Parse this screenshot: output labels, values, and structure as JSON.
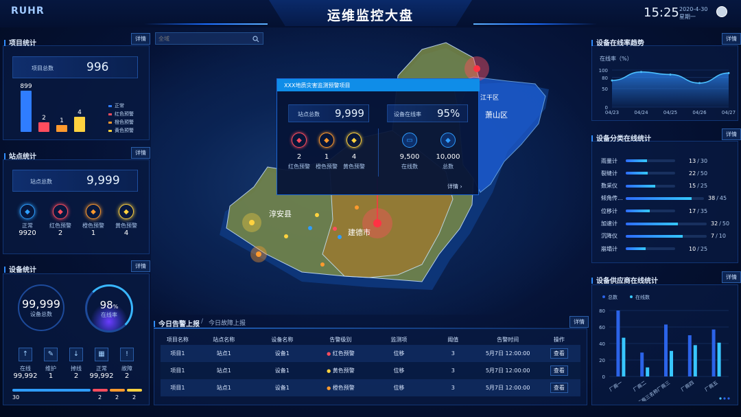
{
  "header": {
    "logo": "RUHR",
    "title": "运维监控大盘",
    "time": "15:25",
    "date": "2020-4-30",
    "weekday": "星期一"
  },
  "left": {
    "project": {
      "title": "项目统计",
      "detail": "详情",
      "total_label": "项目总数",
      "total": "996",
      "bars": [
        {
          "label": "正常",
          "value": 899,
          "color": "#2f7dff"
        },
        {
          "label": "红色预警",
          "value": 2,
          "color": "#ff4d5e"
        },
        {
          "label": "橙色预警",
          "value": 1,
          "color": "#ff9a2e"
        },
        {
          "label": "黄色预警",
          "value": 4,
          "color": "#ffd23f"
        }
      ],
      "bar_values": [
        "899",
        "2",
        "1",
        "4"
      ]
    },
    "site": {
      "title": "站点统计",
      "detail": "详情",
      "total_label": "站点总数",
      "total": "9,999",
      "items": [
        {
          "label": "正常",
          "value": "9920",
          "color": "#2fa0ff"
        },
        {
          "label": "红色预警",
          "value": "2",
          "color": "#ff4d5e"
        },
        {
          "label": "橙色预警",
          "value": "1",
          "color": "#ff9a2e"
        },
        {
          "label": "黄色预警",
          "value": "4",
          "color": "#ffd23f"
        }
      ]
    },
    "device": {
      "title": "设备统计",
      "detail": "详情",
      "total": "99,999",
      "total_label": "设备总数",
      "rate": "98",
      "rate_unit": "%",
      "rate_label": "在线率",
      "items": [
        {
          "label": "在线",
          "value": "99,992"
        },
        {
          "label": "维护",
          "value": "1"
        },
        {
          "label": "掉线",
          "value": "2"
        },
        {
          "label": "正常",
          "value": "99,992"
        },
        {
          "label": "故障",
          "value": "2"
        }
      ],
      "bottom": [
        {
          "value": "30",
          "color": "#2f9dff"
        },
        {
          "value": "2",
          "color": "#ff4d5e"
        },
        {
          "value": "2",
          "color": "#ff9a2e"
        },
        {
          "value": "2",
          "color": "#ffd23f"
        }
      ]
    }
  },
  "map": {
    "search_placeholder": "全域",
    "places": [
      "淳安县",
      "建德市",
      "萧山区",
      "江干区"
    ],
    "popup": {
      "title": "XXX地质灾害监测预警项目",
      "site_label": "站点总数",
      "site_total": "9,999",
      "online_label": "设备在线率",
      "online_rate": "95%",
      "alerts": [
        {
          "label": "红色预警",
          "value": "2",
          "color": "#ff4d5e"
        },
        {
          "label": "橙色预警",
          "value": "1",
          "color": "#ff9a2e"
        },
        {
          "label": "黄色预警",
          "value": "4",
          "color": "#ffd23f"
        }
      ],
      "devices": [
        {
          "label": "在线数",
          "value": "9,500"
        },
        {
          "label": "总数",
          "value": "10,000"
        }
      ],
      "detail": "详情"
    }
  },
  "alarm": {
    "tab_active": "今日告警上报",
    "tab_sep": "/",
    "tab_other": "今日故障上报",
    "detail": "详情",
    "columns": [
      "项目名称",
      "站点名称",
      "设备名称",
      "告警级别",
      "监测项",
      "阈值",
      "告警时间",
      "操作"
    ],
    "rows": [
      {
        "project": "项目1",
        "site": "站点1",
        "device": "设备1",
        "level": "红色预警",
        "level_color": "#ff4d5e",
        "item": "位移",
        "threshold": "3",
        "time": "5月7日 12:00:00",
        "action": "查看"
      },
      {
        "project": "项目1",
        "site": "站点1",
        "device": "设备1",
        "level": "黄色预警",
        "level_color": "#ffd23f",
        "item": "位移",
        "threshold": "3",
        "time": "5月7日 12:00:00",
        "action": "查看"
      },
      {
        "project": "项目1",
        "site": "站点1",
        "device": "设备1",
        "level": "橙色预警",
        "level_color": "#ff9a2e",
        "item": "位移",
        "threshold": "3",
        "time": "5月7日 12:00:00",
        "action": "查看"
      }
    ]
  },
  "right": {
    "trend": {
      "title": "设备在线率趋势",
      "detail": "详情",
      "ylabel": "在线率（%）"
    },
    "category": {
      "title": "设备分类在线统计",
      "detail": "详情",
      "items": [
        {
          "label": "雨量计",
          "online": "13",
          "total": "30",
          "ratio": 0.433
        },
        {
          "label": "裂缝计",
          "online": "22",
          "total": "50",
          "ratio": 0.44
        },
        {
          "label": "数采仪",
          "online": "15",
          "total": "25",
          "ratio": 0.6
        },
        {
          "label": "倾角传...",
          "online": "38",
          "total": "45",
          "ratio": 0.844
        },
        {
          "label": "位移计",
          "online": "17",
          "total": "35",
          "ratio": 0.486
        },
        {
          "label": "加速计",
          "online": "32",
          "total": "50",
          "ratio": 0.64
        },
        {
          "label": "沉降仪",
          "online": "7",
          "total": "10",
          "ratio": 0.7
        },
        {
          "label": "崩塌计",
          "online": "10",
          "total": "25",
          "ratio": 0.4
        }
      ]
    },
    "vendor": {
      "title": "设备供应商在线统计",
      "detail": "详情"
    }
  },
  "chart_data": [
    {
      "type": "line",
      "title": "",
      "ylabel": "在线率（%）",
      "x": [
        "04/23",
        "04/24",
        "04/25",
        "04/26",
        "04/27"
      ],
      "series": [
        {
          "values": [
            72,
            95,
            88,
            65,
            92
          ]
        }
      ],
      "ylim": [
        0,
        100
      ],
      "yticks": [
        "0",
        "50",
        "80",
        "100"
      ]
    },
    {
      "type": "bar",
      "categories": [
        "厂商一",
        "厂商二",
        "厂商三名称厂商三名...",
        "厂商四",
        "厂商五"
      ],
      "series": [
        {
          "name": "总数",
          "values": [
            80,
            29,
            63,
            50,
            57
          ],
          "color": "#2b63e8"
        },
        {
          "name": "在线数",
          "values": [
            47,
            11,
            31,
            38,
            41
          ],
          "color": "#38c7ff"
        }
      ],
      "ylim": [
        0,
        80
      ],
      "yticks": [
        "0",
        "20",
        "40",
        "60",
        "80"
      ]
    }
  ]
}
